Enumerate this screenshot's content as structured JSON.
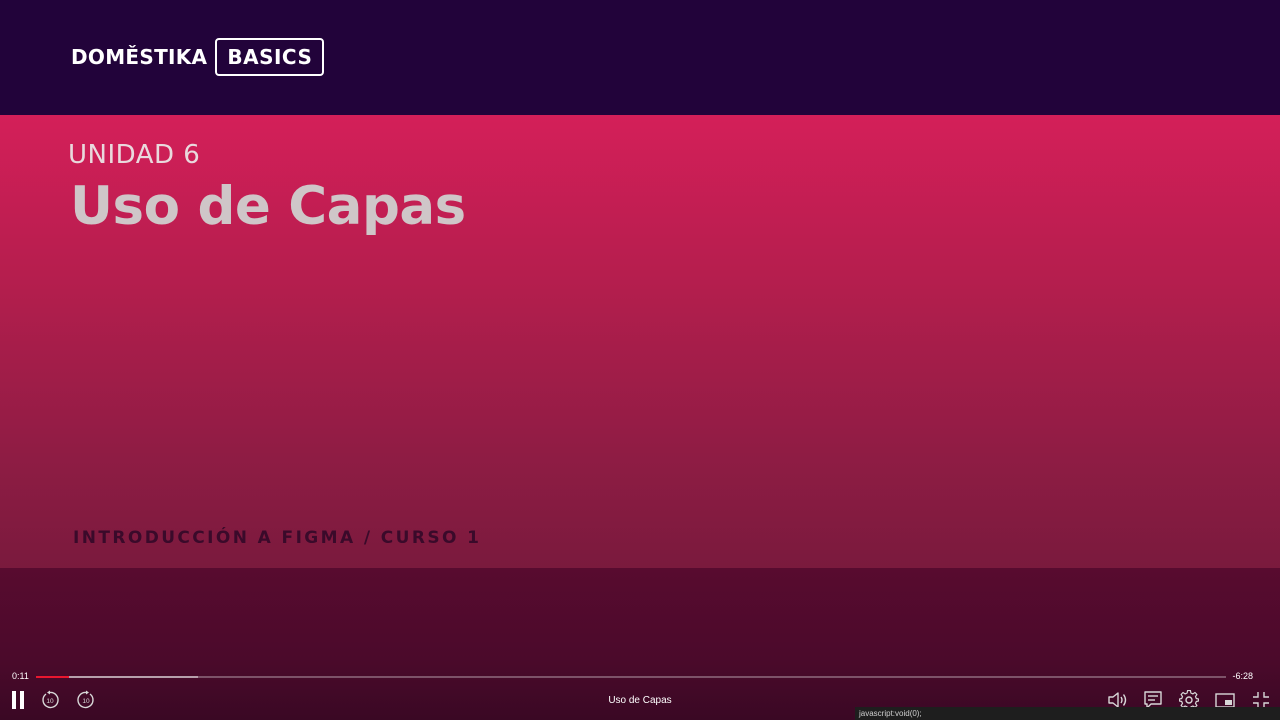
{
  "brand": {
    "word": "DOMĚSTIKA",
    "badge": "BASICS"
  },
  "slide": {
    "unit_label": "UNIDAD 6",
    "title": "Uso de Capas",
    "course": "INTRODUCCIÓN A FIGMA / CURSO 1"
  },
  "player": {
    "current_time": "0:11",
    "remaining_time": "-6:28",
    "played_fraction": 0.028,
    "buffered_fraction": 0.136,
    "video_title": "Uso de Capas",
    "status_link": "javascript:void(0);",
    "icons": {
      "play_pause": "pause-icon",
      "rewind": "rewind-10-icon",
      "forward": "forward-10-icon",
      "volume": "volume-icon",
      "subtitles": "subtitles-icon",
      "settings": "gear-icon",
      "pip": "picture-in-picture-icon",
      "fullscreen": "exit-fullscreen-icon"
    },
    "colors": {
      "played": "#e8172f",
      "slide_top": "#d41f59",
      "header_bg": "#22033a"
    }
  }
}
